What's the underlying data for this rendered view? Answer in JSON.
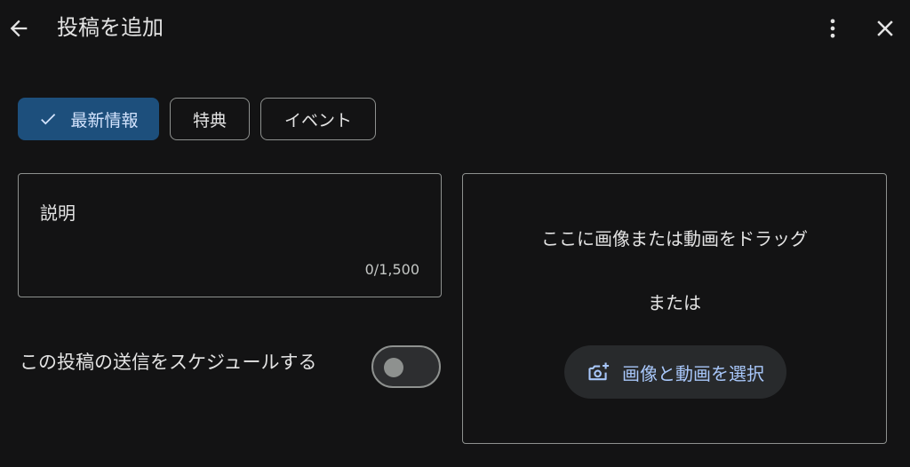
{
  "header": {
    "title": "投稿を追加"
  },
  "post_types": [
    {
      "label": "最新情報",
      "selected": true
    },
    {
      "label": "特典",
      "selected": false
    },
    {
      "label": "イベント",
      "selected": false
    }
  ],
  "description": {
    "label": "説明",
    "counter": "0/1,500"
  },
  "schedule": {
    "label": "この投稿の送信をスケジュールする",
    "enabled": false
  },
  "media": {
    "drop_text": "ここに画像または動画をドラッグ",
    "or_text": "または",
    "select_button_label": "画像と動画を選択"
  },
  "colors": {
    "background": "#131314",
    "selected_chip": "#1d4f7c",
    "accent_text": "#a8c7fa",
    "border": "#8e918f"
  },
  "icons": {
    "back": "arrow-left-icon",
    "more": "more-vertical-icon",
    "close": "close-icon",
    "check": "check-icon",
    "camera_add": "add-photo-icon"
  }
}
